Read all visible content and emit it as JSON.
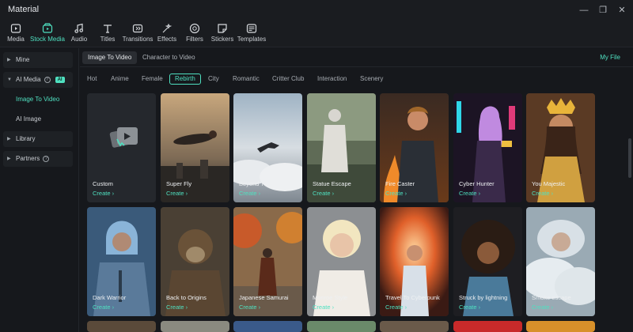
{
  "window": {
    "title": "Material",
    "min": "—",
    "max": "❐",
    "close": "✕"
  },
  "toolbar": [
    {
      "label": "Media",
      "icon": "media-icon"
    },
    {
      "label": "Stock Media",
      "icon": "stock-media-icon",
      "active": true
    },
    {
      "label": "Audio",
      "icon": "music-note-icon"
    },
    {
      "label": "Titles",
      "icon": "text-icon"
    },
    {
      "label": "Transitions",
      "icon": "transitions-icon"
    },
    {
      "label": "Effects",
      "icon": "effects-icon"
    },
    {
      "label": "Filters",
      "icon": "filters-icon"
    },
    {
      "label": "Stickers",
      "icon": "stickers-icon"
    },
    {
      "label": "Templates",
      "icon": "templates-icon"
    }
  ],
  "sidebar": {
    "mine": "Mine",
    "ai_media": "AI Media",
    "ai_badge": "AI",
    "image_to_video": "Image To Video",
    "ai_image": "AI Image",
    "library": "Library",
    "partners": "Partners"
  },
  "tabs": {
    "image_to_video": "Image To Video",
    "character_to_video": "Character to Video",
    "my_file": "My File"
  },
  "categories": [
    "Hot",
    "Anime",
    "Female",
    "Rebirth",
    "City",
    "Romantic",
    "Critter Club",
    "Interaction",
    "Scenery"
  ],
  "active_category": "Rebirth",
  "cards": [
    {
      "name": "Custom",
      "cta": "Create ›"
    },
    {
      "name": "Super Fly",
      "cta": "Create ›"
    },
    {
      "name": "Beyond The Clouds",
      "cta": "Create ›"
    },
    {
      "name": "Statue Escape",
      "cta": "Create ›"
    },
    {
      "name": "Fire Caster",
      "cta": "Create ›"
    },
    {
      "name": "Cyber Hunter",
      "cta": "Create ›"
    },
    {
      "name": "You Majestic",
      "cta": "Create ›"
    },
    {
      "name": "Dark Warrior",
      "cta": "Create ›"
    },
    {
      "name": "Back to Origins",
      "cta": "Create ›"
    },
    {
      "name": "Japanese Samurai",
      "cta": "Create ›"
    },
    {
      "name": "Monroe Style",
      "cta": "Create ›"
    },
    {
      "name": "Travel To Cyberpunk",
      "cta": "Create ›"
    },
    {
      "name": "Struck by lightning",
      "cta": "Create ›"
    },
    {
      "name": "Smoke escape",
      "cta": "Create ›"
    }
  ],
  "colors": {
    "accent": "#4fe0c0",
    "bg": "#16181c"
  }
}
